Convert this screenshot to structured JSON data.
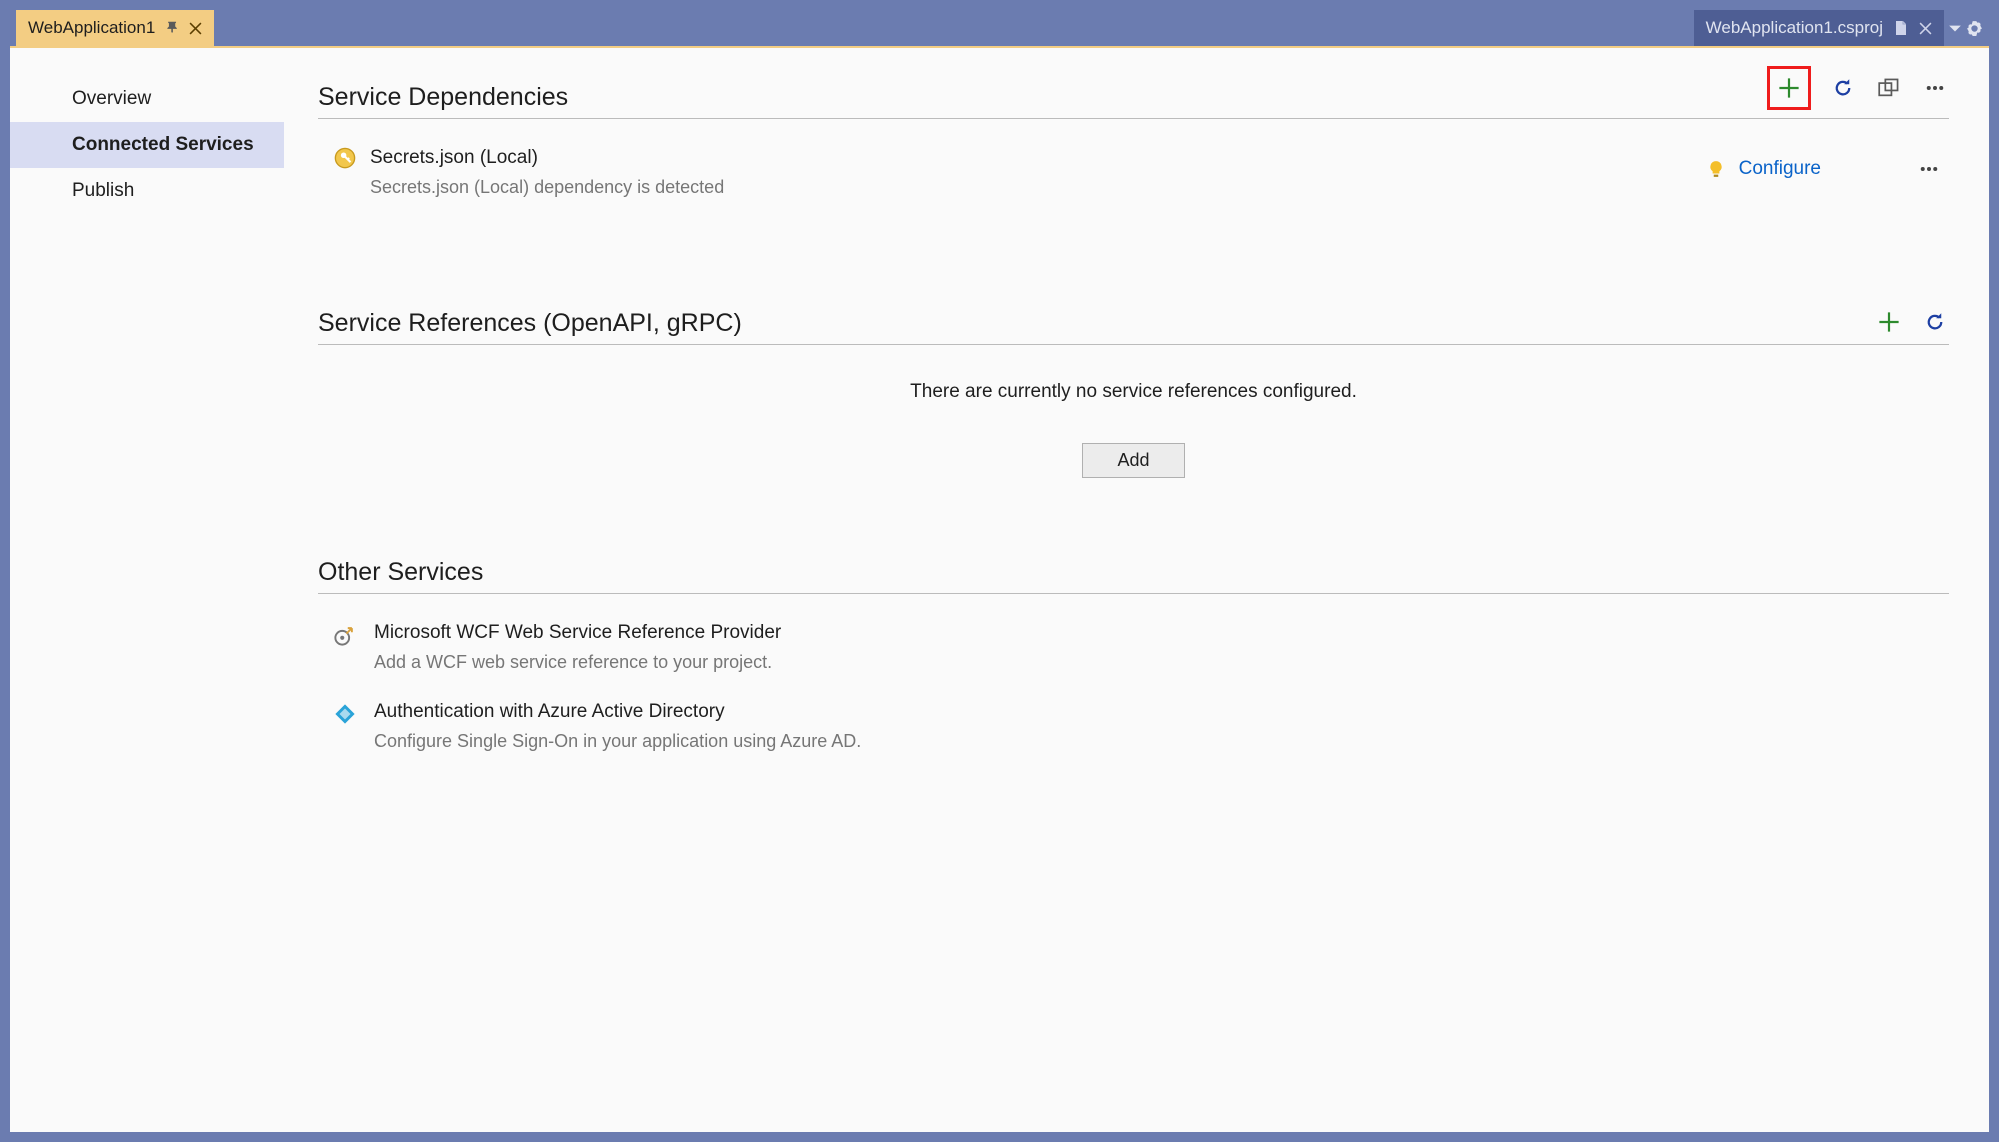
{
  "tabs": {
    "left": {
      "title": "WebApplication1"
    },
    "right": {
      "title": "WebApplication1.csproj"
    }
  },
  "sidebar": {
    "items": [
      {
        "label": "Overview"
      },
      {
        "label": "Connected Services"
      },
      {
        "label": "Publish"
      }
    ]
  },
  "sections": {
    "dependencies": {
      "title": "Service Dependencies",
      "items": [
        {
          "title": "Secrets.json (Local)",
          "subtitle": "Secrets.json (Local) dependency is detected",
          "action": "Configure"
        }
      ]
    },
    "references": {
      "title": "Service References (OpenAPI, gRPC)",
      "empty_message": "There are currently no service references configured.",
      "add_label": "Add"
    },
    "other": {
      "title": "Other Services",
      "items": [
        {
          "title": "Microsoft WCF Web Service Reference Provider",
          "desc": "Add a WCF web service reference to your project."
        },
        {
          "title": "Authentication with Azure Active Directory",
          "desc": "Configure Single Sign-On in your application using Azure AD."
        }
      ]
    }
  }
}
